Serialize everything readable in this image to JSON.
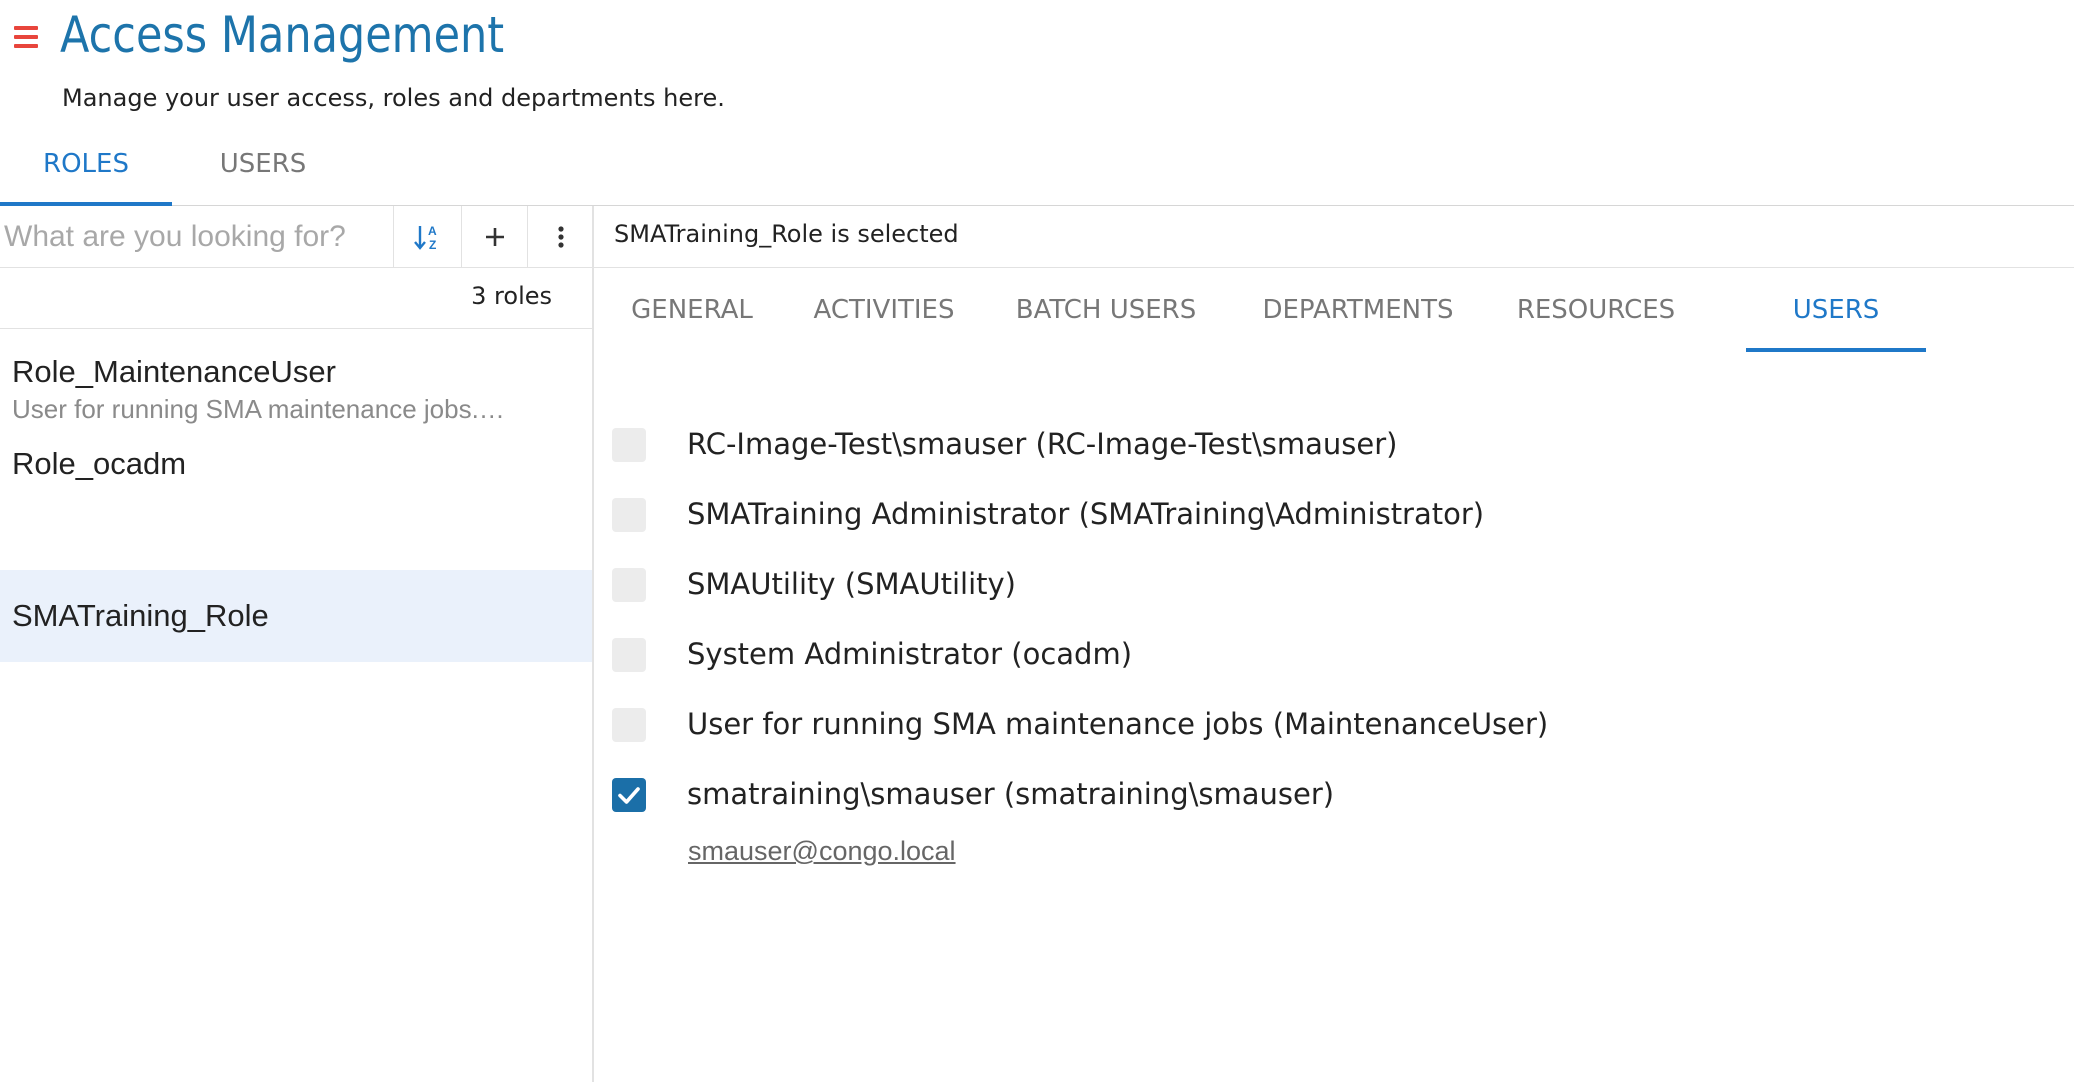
{
  "header": {
    "title": "Access Management",
    "subtitle": "Manage your user access, roles and departments here."
  },
  "main_tabs": [
    {
      "label": "ROLES",
      "active": true
    },
    {
      "label": "USERS",
      "active": false
    }
  ],
  "roles_panel": {
    "search_placeholder": "What are you looking for?",
    "count_label": "3 roles",
    "roles": [
      {
        "name": "Role_MaintenanceUser",
        "description": "User for running SMA maintenance jobs.…",
        "selected": false
      },
      {
        "name": "Role_ocadm",
        "description": "",
        "selected": false
      },
      {
        "name": "SMATraining_Role",
        "description": "",
        "selected": true
      }
    ]
  },
  "detail": {
    "selected_text": "SMATraining_Role is selected",
    "tabs": [
      {
        "label": "GENERAL",
        "active": false
      },
      {
        "label": "ACTIVITIES",
        "active": false
      },
      {
        "label": "BATCH USERS",
        "active": false
      },
      {
        "label": "DEPARTMENTS",
        "active": false
      },
      {
        "label": "RESOURCES",
        "active": false
      },
      {
        "label": "USERS",
        "active": true
      }
    ],
    "users": [
      {
        "label": "RC-Image-Test\\smauser (RC-Image-Test\\smauser)",
        "checked": false
      },
      {
        "label": "SMATraining Administrator (SMATraining\\Administrator)",
        "checked": false
      },
      {
        "label": "SMAUtility (SMAUtility)",
        "checked": false
      },
      {
        "label": "System Administrator (ocadm)",
        "checked": false
      },
      {
        "label": "User for running SMA maintenance jobs (MaintenanceUser)",
        "checked": false
      },
      {
        "label": "smatraining\\smauser (smatraining\\smauser)",
        "checked": true
      }
    ],
    "checked_user_email": "smauser@congo.local"
  },
  "colors": {
    "accent": "#1f78c8",
    "title": "#1d74ab",
    "menu_icon": "#e8453c",
    "selected_row": "#eaf1fb",
    "checkbox_checked": "#1b6fa8"
  }
}
